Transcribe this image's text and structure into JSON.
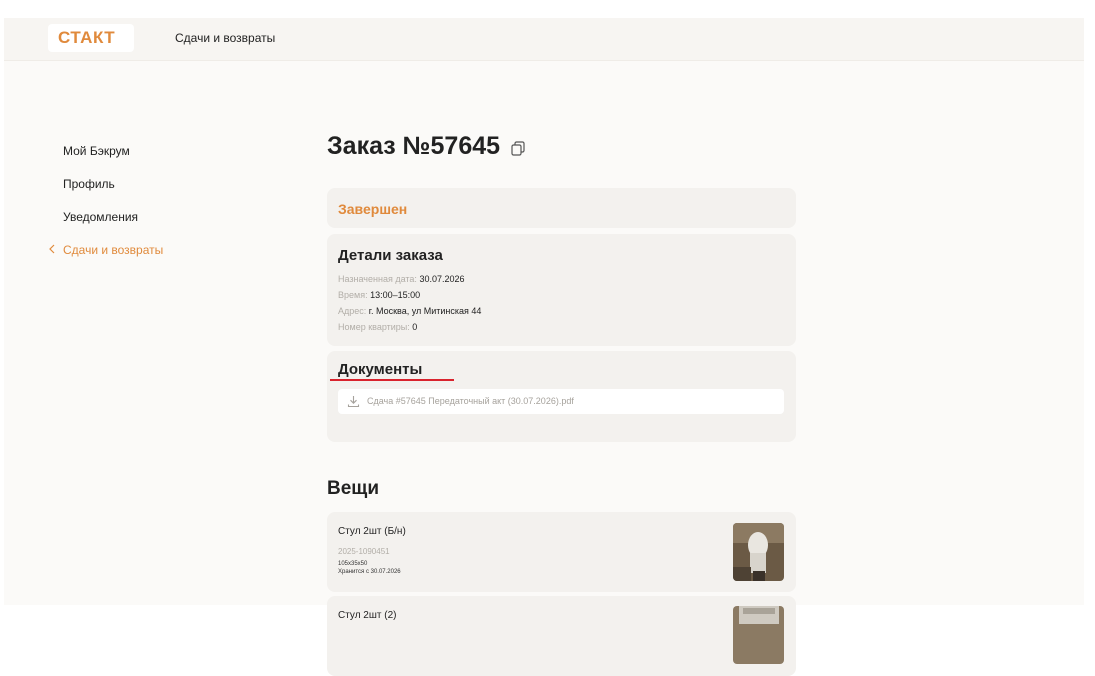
{
  "header": {
    "logo": "СТАКТ",
    "nav_link": "Сдачи и возвраты"
  },
  "sidebar": {
    "items": [
      {
        "label": "Мой Бэкрум"
      },
      {
        "label": "Профиль"
      },
      {
        "label": "Уведомления"
      },
      {
        "label": "Сдачи и возвраты",
        "active": true,
        "icon": "chevron-left-icon"
      }
    ]
  },
  "order": {
    "title": "Заказ №57645",
    "copy_icon": "copy-icon",
    "status": "Завершен",
    "details": {
      "heading": "Детали заказа",
      "rows": [
        {
          "label": "Назначенная дата:",
          "value": "30.07.2026"
        },
        {
          "label": "Время:",
          "value": "13:00–15:00"
        },
        {
          "label": "Адрес:",
          "value": "г. Москва, ул Митинская 44"
        },
        {
          "label": "Номер квартиры:",
          "value": "0"
        }
      ]
    },
    "documents": {
      "heading": "Документы",
      "files": [
        {
          "name": "Сдача #57645 Передаточный акт (30.07.2026).pdf",
          "icon": "download-icon"
        }
      ]
    }
  },
  "items": {
    "heading": "Вещи",
    "list": [
      {
        "name": "Стул 2шт (Б/н)",
        "sku": "2025-1090451",
        "dims": "105x35x50",
        "stored": "Хранится с 30.07.2026"
      },
      {
        "name": "Стул 2шт (2)",
        "sku": "",
        "dims": "",
        "stored": ""
      }
    ]
  },
  "colors": {
    "accent": "#e08a3c",
    "card_bg": "#f3f1ee",
    "annotation_red": "#d9232d"
  }
}
